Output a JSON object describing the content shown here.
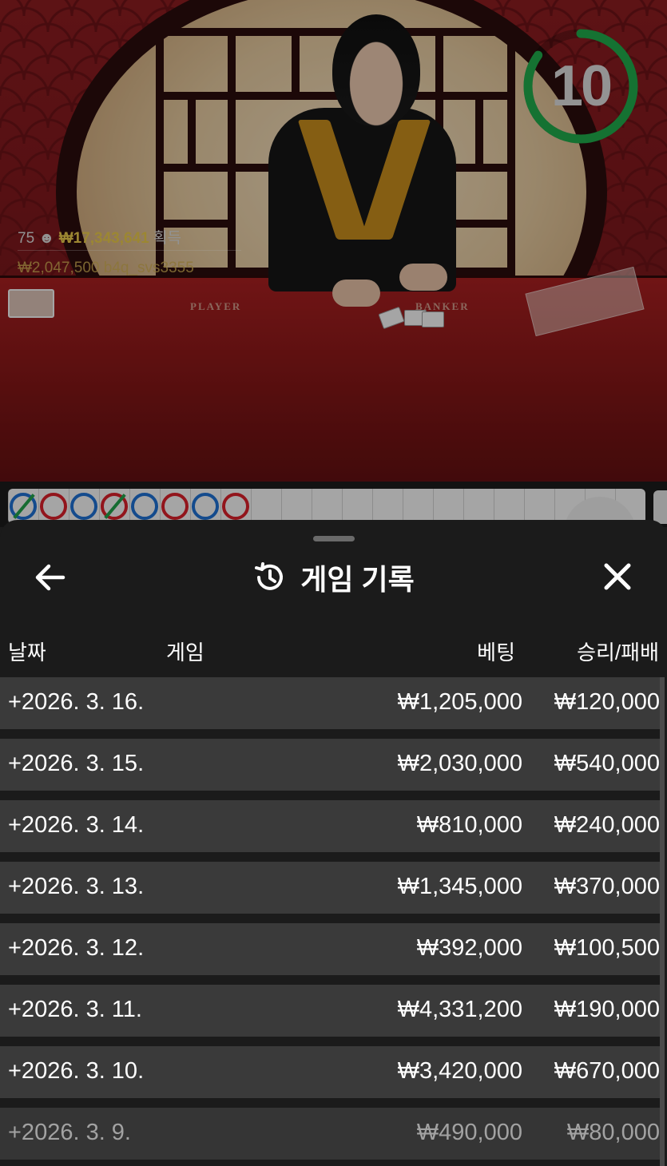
{
  "stream": {
    "player_count": "75",
    "total_winnings": "₩17,343,641",
    "winnings_suffix": "획득",
    "last_winner_amount": "₩2,047,500",
    "last_winner_name": "b4q_svs3355",
    "table_label_player": "PLAYER",
    "table_label_banker": "BANKER",
    "countdown": "10",
    "countdown_progress": 0.85
  },
  "road": {
    "beads": [
      "blue-tie",
      "red",
      "blue",
      "red-tie",
      "blue",
      "red",
      "blue",
      "red"
    ]
  },
  "sheet": {
    "title": "게임 기록",
    "back_icon": "arrow-left-icon",
    "history_icon": "history-icon",
    "close_icon": "close-icon"
  },
  "table": {
    "headers": {
      "date": "날짜",
      "game": "게임",
      "bet": "베팅",
      "win_loss": "승리/패배"
    },
    "rows": [
      {
        "date": "+2026. 3. 16.",
        "bet": "₩1,205,000",
        "win_loss": "₩120,000"
      },
      {
        "date": "+2026. 3. 15.",
        "bet": "₩2,030,000",
        "win_loss": "₩540,000"
      },
      {
        "date": "+2026. 3. 14.",
        "bet": "₩810,000",
        "win_loss": "₩240,000"
      },
      {
        "date": "+2026. 3. 13.",
        "bet": "₩1,345,000",
        "win_loss": "₩370,000"
      },
      {
        "date": "+2026. 3. 12.",
        "bet": "₩392,000",
        "win_loss": "₩100,500"
      },
      {
        "date": "+2026. 3. 11.",
        "bet": "₩4,331,200",
        "win_loss": "₩190,000"
      },
      {
        "date": "+2026. 3. 10.",
        "bet": "₩3,420,000",
        "win_loss": "₩670,000"
      },
      {
        "date": "+2026. 3. 9.",
        "bet": "₩490,000",
        "win_loss": "₩80,000"
      }
    ]
  },
  "colors": {
    "timer_ring": "#1fa84a",
    "amount_gold": "#e6c74a",
    "player_blue": "#1e6fd0",
    "banker_red": "#d8202a",
    "tie_green": "#21a04a"
  }
}
